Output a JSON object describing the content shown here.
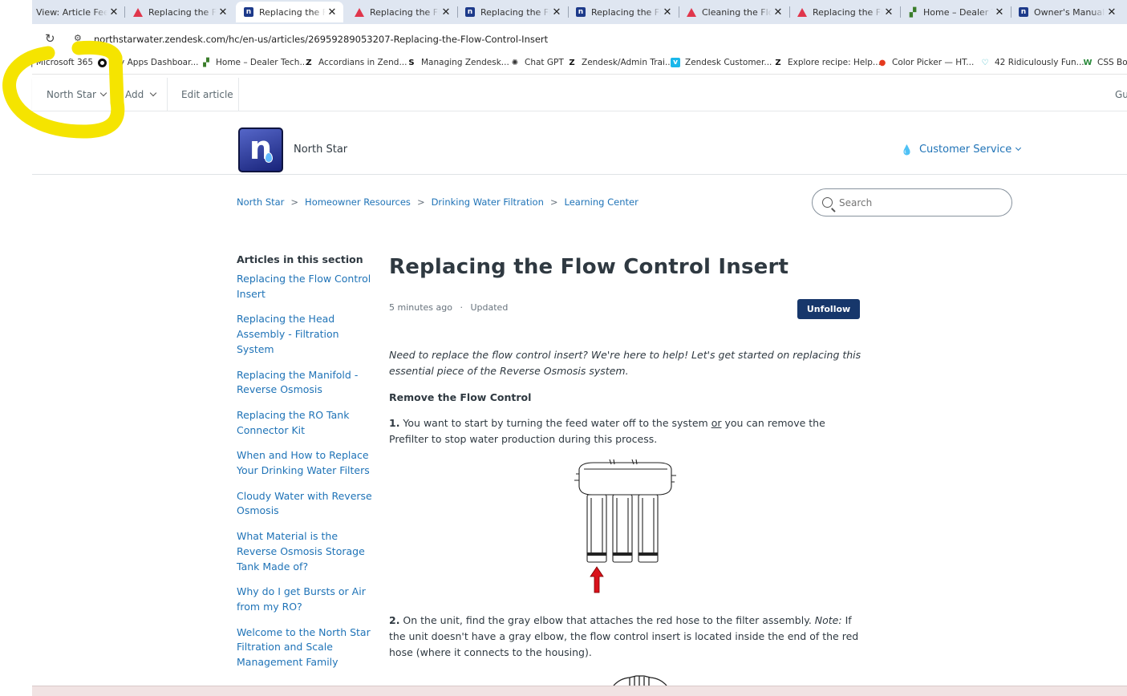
{
  "tabs": [
    {
      "title": "View: Article Feedb",
      "icon": "zendesk-icon"
    },
    {
      "title": "Replacing the Flow",
      "icon": "zendesk-icon"
    },
    {
      "title": "Replacing the Flow",
      "icon": "northstar-icon",
      "active": true
    },
    {
      "title": "Replacing the Flow",
      "icon": "zendesk-icon"
    },
    {
      "title": "Replacing the Flow",
      "icon": "northstar-icon"
    },
    {
      "title": "Replacing the Flow",
      "icon": "northstar-icon"
    },
    {
      "title": "Cleaning the Flow",
      "icon": "zendesk-icon"
    },
    {
      "title": "Replacing the Flow",
      "icon": "zendesk-icon"
    },
    {
      "title": "Home – Dealer Te",
      "icon": "dealertech-icon"
    },
    {
      "title": "Owner's Manuals",
      "icon": "northstar-icon"
    }
  ],
  "address": {
    "url": "northstarwater.zendesk.com/hc/en-us/articles/26959289053207-Replacing-the-Flow-Control-Insert"
  },
  "bookmarks": [
    {
      "label": "| Microsoft 365",
      "icon": "microsoft-icon"
    },
    {
      "label": "My Apps Dashboar...",
      "icon": "apps-icon"
    },
    {
      "label": "Home – Dealer Tech...",
      "icon": "dealertech-icon"
    },
    {
      "label": "Accordians in Zend...",
      "icon": "zendesk-icon"
    },
    {
      "label": "Managing Zendesk...",
      "icon": "s-icon"
    },
    {
      "label": "Chat GPT",
      "icon": "chatgpt-icon"
    },
    {
      "label": "Zendesk/Admin Trai...",
      "icon": "zendesk-icon"
    },
    {
      "label": "Zendesk Customer...",
      "icon": "vimeo-icon"
    },
    {
      "label": "Explore recipe: Help...",
      "icon": "zendesk-icon"
    },
    {
      "label": "Color Picker — HT...",
      "icon": "colorpicker-icon"
    },
    {
      "label": "42 Ridiculously Fun...",
      "icon": "heart-icon"
    },
    {
      "label": "CSS Bord",
      "icon": "w-icon"
    }
  ],
  "toolbar": {
    "brand_menu": "North Star",
    "add_menu": "Add",
    "edit_article": "Edit article",
    "right_cut": "Gu"
  },
  "header": {
    "logo_letter": "n",
    "brand_name": "North Star",
    "customer_service": "Customer Service"
  },
  "breadcrumb": [
    "North Star",
    "Homeowner Resources",
    "Drinking Water Filtration",
    "Learning Center"
  ],
  "breadcrumb_sep": ">",
  "search": {
    "placeholder": "Search"
  },
  "sidebar": {
    "heading": "Articles in this section",
    "items": [
      "Replacing the Flow Control Insert",
      "Replacing the Head Assembly - Filtration System",
      "Replacing the Manifold - Reverse Osmosis",
      "Replacing the RO Tank Connector Kit",
      "When and How to Replace Your Drinking Water Filters",
      "Cloudy Water with Reverse Osmosis",
      "What Material is the Reverse Osmosis Storage Tank Made of?",
      "Why do I get Bursts or Air from my RO?",
      "Welcome to the North Star Filtration and Scale Management Family"
    ]
  },
  "article": {
    "title": "Replacing the Flow Control Insert",
    "time": "5 minutes ago",
    "dot": "·",
    "status": "Updated",
    "unfollow": "Unfollow",
    "intro": "Need to replace the flow control insert? We're here to help! Let's get started on replacing this essential piece of the Reverse Osmosis system.",
    "section_heading": "Remove the Flow Control",
    "step1_num": "1.",
    "step1_a": " You want to start by turning the feed water off to the system ",
    "step1_or": "or",
    "step1_b": " you can remove the Prefilter to stop water production during this process.",
    "step2_num": "2.",
    "step2_a": " On the unit, find the gray elbow that attaches the red hose to the filter assembly. ",
    "step2_note": "Note:",
    "step2_b": " If the unit doesn't have a gray elbow, the flow control insert is located inside the end of the red hose (where it connects to the housing)."
  },
  "colors": {
    "link": "#1f73b7",
    "button": "#17376b",
    "highlight": "#f5e400",
    "arrow": "#d9121b"
  }
}
